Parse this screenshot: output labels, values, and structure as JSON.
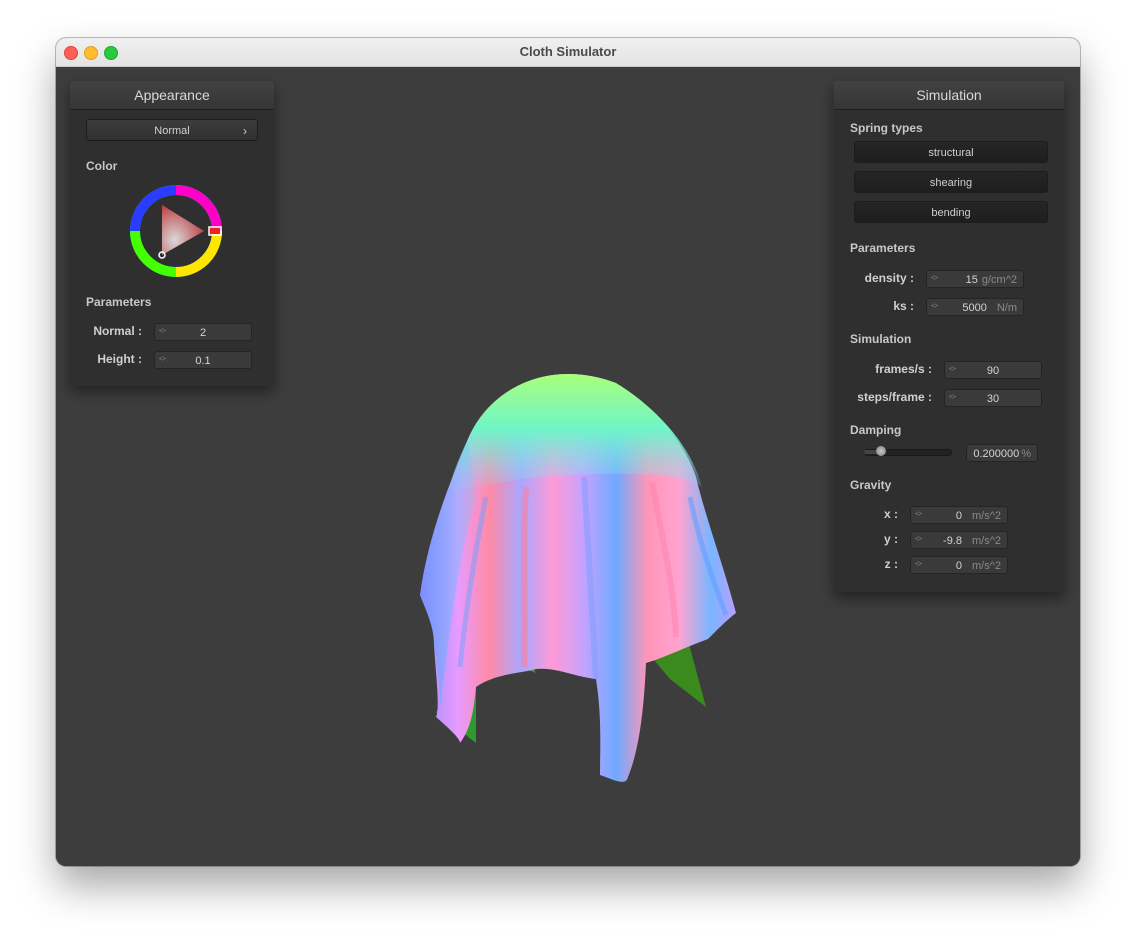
{
  "window": {
    "title": "Cloth Simulator"
  },
  "appearance": {
    "title": "Appearance",
    "shader_select": {
      "value": "Normal",
      "chevron": "›"
    },
    "color_label": "Color",
    "parameters_label": "Parameters",
    "normal": {
      "label": "Normal :",
      "value": "2"
    },
    "height": {
      "label": "Height :",
      "value": "0.1"
    }
  },
  "simulation": {
    "title": "Simulation",
    "spring_types_label": "Spring types",
    "springs": [
      "structural",
      "shearing",
      "bending"
    ],
    "parameters_label": "Parameters",
    "density": {
      "label": "density :",
      "value": "15",
      "unit": "g/cm^2"
    },
    "ks": {
      "label": "ks :",
      "value": "5000",
      "unit": "N/m"
    },
    "simulation_label": "Simulation",
    "fps": {
      "label": "frames/s :",
      "value": "90"
    },
    "steps": {
      "label": "steps/frame :",
      "value": "30"
    },
    "damping_label": "Damping",
    "damping": {
      "value": "0.200000",
      "unit": "%",
      "slider_fraction": 0.2
    },
    "gravity_label": "Gravity",
    "gravity": [
      {
        "label": "x :",
        "value": "0",
        "unit": "m/s^2"
      },
      {
        "label": "y :",
        "value": "-9.8",
        "unit": "m/s^2"
      },
      {
        "label": "z :",
        "value": "0",
        "unit": "m/s^2"
      }
    ]
  },
  "colors": {
    "accent_red": "#e8242b",
    "panel_bg": "#2f2f2f",
    "viewport_bg": "#3d3d3d"
  }
}
